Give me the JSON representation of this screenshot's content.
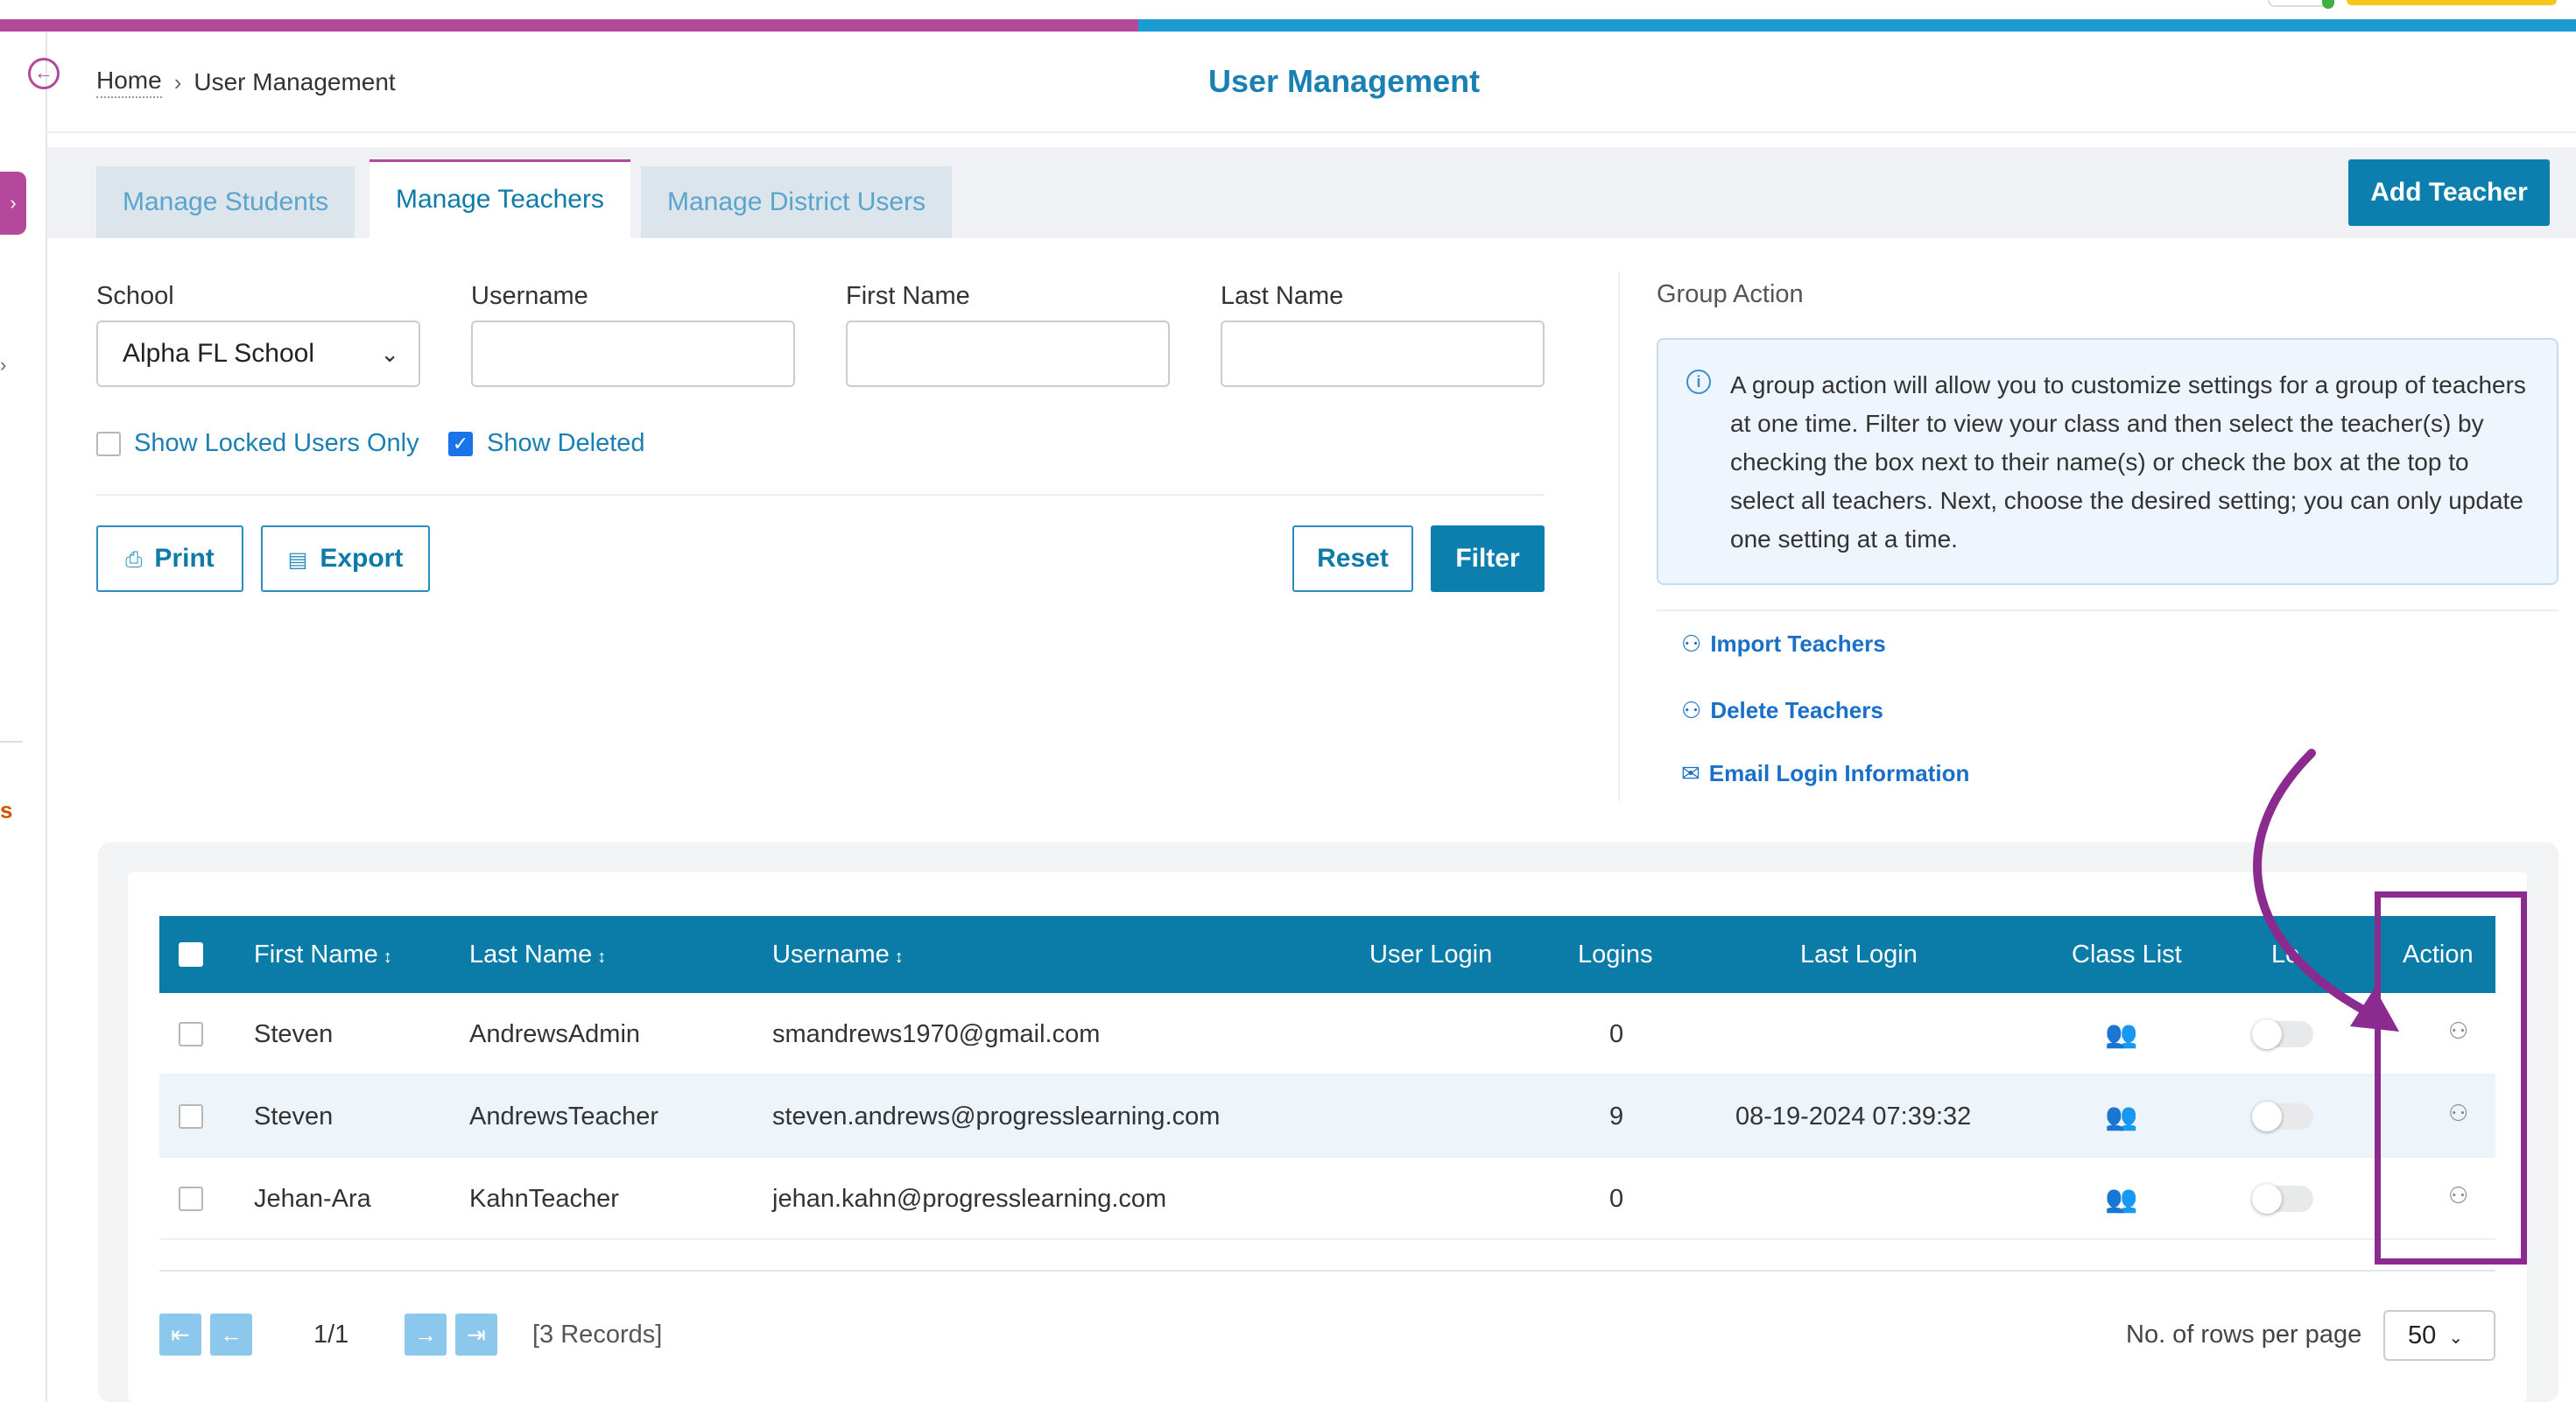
{
  "breadcrumb": {
    "home": "Home",
    "separator": "›",
    "current": "User Management"
  },
  "page": {
    "title": "User Management"
  },
  "tabs": [
    {
      "label": "Manage Students",
      "active": false
    },
    {
      "label": "Manage Teachers",
      "active": true
    },
    {
      "label": "Manage District Users",
      "active": false
    }
  ],
  "add_button": "Add Teacher",
  "filters": {
    "school_label": "School",
    "school_value": "Alpha FL School",
    "username_label": "Username",
    "username_value": "",
    "firstname_label": "First Name",
    "firstname_value": "",
    "lastname_label": "Last Name",
    "lastname_value": "",
    "locked_label": "Show Locked Users Only",
    "locked_checked": false,
    "deleted_label": "Show Deleted",
    "deleted_checked": true
  },
  "buttons": {
    "print": "Print",
    "export": "Export",
    "reset": "Reset",
    "filter": "Filter"
  },
  "group_action": {
    "title": "Group Action",
    "info": "A group action will allow you to customize settings for a group of teachers at one time. Filter to view your class and then select the teacher(s) by checking the box next to their name(s) or check the box at the top to select all teachers. Next, choose the desired setting; you can only update one setting at a time.",
    "links": [
      "Import Teachers",
      "Delete Teachers",
      "Email Login Information"
    ]
  },
  "table": {
    "columns": [
      "First Name",
      "Last Name",
      "Username",
      "User Login",
      "Logins",
      "Last Login",
      "Class List",
      "Lo",
      "Action"
    ],
    "rows": [
      {
        "first": "Steven",
        "last": "AndrewsAdmin",
        "username": "smandrews1970@gmail.com",
        "user_login": "",
        "logins": "0",
        "last_login": ""
      },
      {
        "first": "Steven",
        "last": "AndrewsTeacher",
        "username": "steven.andrews@progresslearning.com",
        "user_login": "",
        "logins": "9",
        "last_login": "08-19-2024 07:39:32"
      },
      {
        "first": "Jehan-Ara",
        "last": "KahnTeacher",
        "username": "jehan.kahn@progresslearning.com",
        "user_login": "",
        "logins": "0",
        "last_login": ""
      }
    ]
  },
  "pagination": {
    "page": "1/1",
    "records": "[3 Records]",
    "rows_label": "No. of rows per page",
    "rows_value": "50"
  },
  "colors": {
    "brand": "#b4499c",
    "accent": "#1a9bd1",
    "header": "#0b7ca8",
    "annotation": "#8b2a8f"
  },
  "icons": [
    "back-arrow-icon",
    "chevron-down-icon",
    "print-icon",
    "export-icon",
    "info-icon",
    "add-user-icon",
    "remove-user-icon",
    "mail-icon",
    "sort-icon",
    "class-list-icon",
    "user-settings-icon",
    "first-page-icon",
    "prev-page-icon",
    "next-page-icon",
    "last-page-icon"
  ]
}
